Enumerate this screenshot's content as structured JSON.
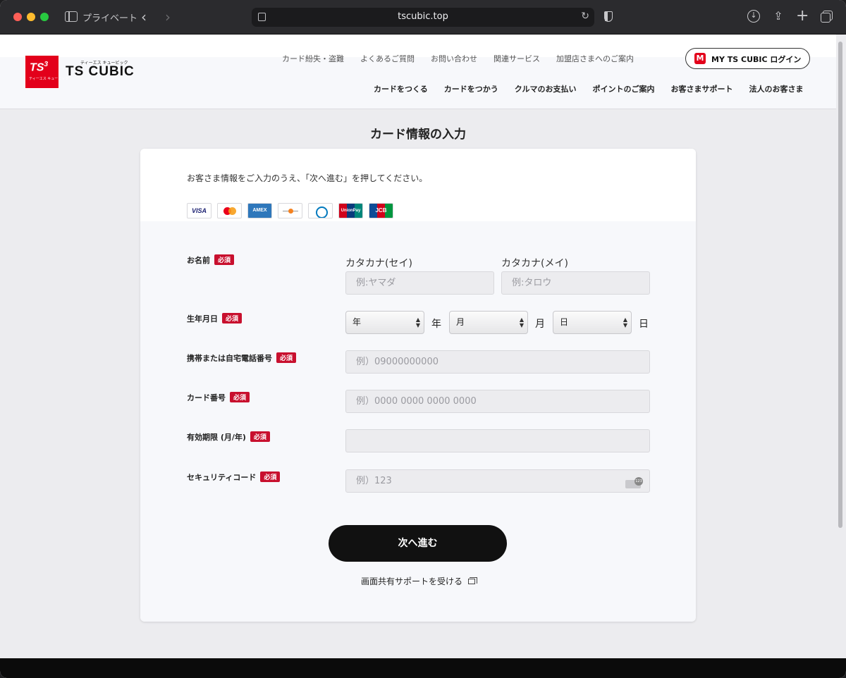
{
  "browser": {
    "private_label": "プライベート",
    "url": "tscubic.top",
    "icons": [
      "sidebar-icon",
      "back-icon",
      "forward-icon",
      "page-icon",
      "reload-icon",
      "shield-icon",
      "download-icon",
      "share-icon",
      "new-tab-icon",
      "tab-overview-icon"
    ]
  },
  "header": {
    "brand_kana": "ティーエス キュービック",
    "brand_name": "TS CUBIC",
    "logo_text": "TS",
    "logo_sup": "3",
    "logo_sub": "ティーエス キュービック",
    "utility_links": [
      "カード紛失・盗難",
      "よくあるご質問",
      "お問い合わせ",
      "関連サービス",
      "加盟店さまへのご案内"
    ],
    "login_label": "MY TS CUBIC ログイン",
    "main_nav": [
      "カードをつくる",
      "カードをつかう",
      "クルマのお支払い",
      "ポイントのご案内",
      "お客さまサポート",
      "法人のお客さま"
    ]
  },
  "form": {
    "title": "カード情報の入力",
    "instructions": "お客さま情報をご入力のうえ、「次へ進む」を押してください。",
    "card_brands": [
      "VISA",
      "",
      "AMEX",
      "",
      "",
      "UnionPay",
      "JCB"
    ],
    "required_badge": "必須",
    "name": {
      "label": "お名前",
      "sei_label": "カタカナ(セイ)",
      "mei_label": "カタカナ(メイ)",
      "sei_placeholder": "例:ヤマダ",
      "mei_placeholder": "例:タロウ"
    },
    "birthdate": {
      "label": "生年月日",
      "year_value": "年",
      "month_value": "月",
      "day_value": "日",
      "year_unit": "年",
      "month_unit": "月",
      "day_unit": "日"
    },
    "phone": {
      "label": "携帯または自宅電話番号",
      "placeholder": "例）09000000000"
    },
    "card_number": {
      "label": "カード番号",
      "placeholder": "例）0000 0000 0000 0000"
    },
    "expiry": {
      "label": "有効期限 (月/年)",
      "placeholder": ""
    },
    "security_code": {
      "label": "セキュリティコード",
      "placeholder": "例）123"
    },
    "next_button": "次へ進む",
    "support_link": "画面共有サポートを受ける"
  },
  "colors": {
    "brand_red": "#e3001b",
    "required_red": "#c8102e",
    "button_black": "#111111",
    "page_bg": "#ececef"
  }
}
